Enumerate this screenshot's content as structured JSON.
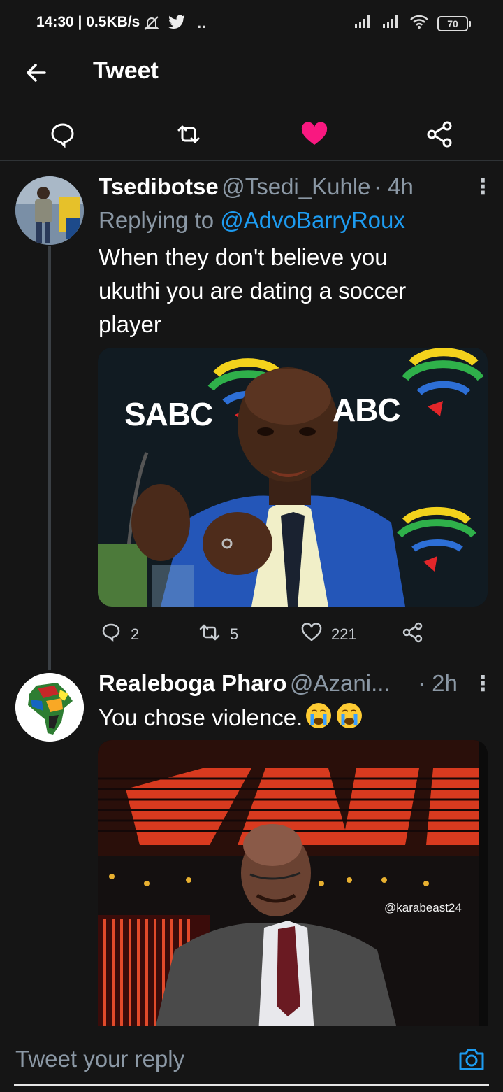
{
  "status_bar": {
    "time": "14:30 | 0.5KB/s",
    "battery": "70"
  },
  "header": {
    "title": "Tweet"
  },
  "action_bar": {
    "icons": [
      "reply-icon",
      "retweet-icon",
      "like-icon",
      "share-icon"
    ],
    "liked_color": "#f91880"
  },
  "tweet1": {
    "name": "Tsedibotse",
    "handle": "@Tsedi_Kuhle",
    "time": "· 4h",
    "replying_label": "Replying to",
    "replying_to": "@AdvoBarryRoux",
    "text_line1": "When they don't believe you",
    "text_line2": "ukuthi you are dating a soccer",
    "text_line3": "player",
    "image_text_left": "SABC",
    "image_text_right": "ABC",
    "replies": "2",
    "retweets": "5",
    "likes": "221"
  },
  "tweet2": {
    "name": "Realeboga Pharo",
    "handle": "@Azani...",
    "time": "· 2h",
    "text": "You chose violence.",
    "watermark": "@karabeast24"
  },
  "reply_bar": {
    "placeholder": "Tweet your reply"
  },
  "colors": {
    "accent": "#1d9bf0",
    "background": "#151515",
    "secondary_text": "#8b98a5"
  }
}
